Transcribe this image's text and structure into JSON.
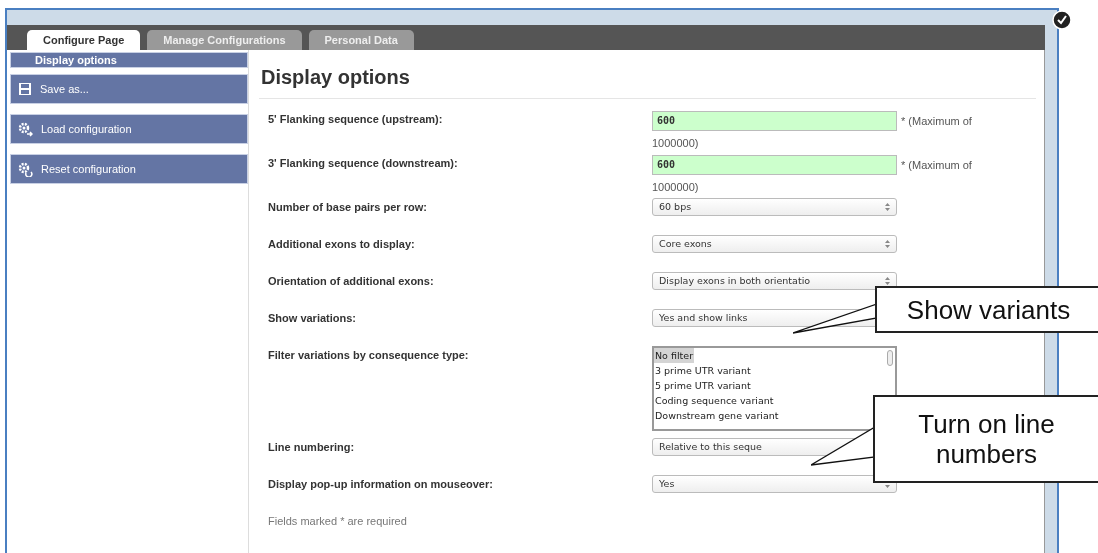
{
  "tabs": [
    {
      "label": "Configure Page",
      "selected": true
    },
    {
      "label": "Manage Configurations",
      "selected": false
    },
    {
      "label": "Personal Data",
      "selected": false
    }
  ],
  "sidebar": {
    "heading": "Display options",
    "items": [
      {
        "kind": "save",
        "label": "Save as..."
      },
      {
        "kind": "load",
        "label": "Load configuration"
      },
      {
        "kind": "reset",
        "label": "Reset configuration"
      }
    ]
  },
  "main": {
    "title": "Display options",
    "fields": [
      {
        "kind": "text",
        "label": "5' Flanking sequence (upstream):",
        "value": "600",
        "note_lines": [
          "* (Maximum of",
          "1000000)"
        ]
      },
      {
        "kind": "text",
        "label": "3' Flanking sequence (downstream):",
        "value": "600",
        "note_lines": [
          "* (Maximum of",
          "1000000)"
        ]
      },
      {
        "kind": "select",
        "label": "Number of base pairs per row:",
        "value": "60 bps"
      },
      {
        "kind": "select",
        "label": "Additional exons to display:",
        "value": "Core exons"
      },
      {
        "kind": "select",
        "label": "Orientation of additional exons:",
        "value": "Display exons in both orientatio"
      },
      {
        "kind": "select",
        "label": "Show variations:",
        "value": "Yes and show links"
      },
      {
        "kind": "list",
        "label": "Filter variations by consequence type:",
        "options": [
          {
            "label": "No filter",
            "selected": true
          },
          {
            "label": "3 prime UTR variant",
            "selected": false
          },
          {
            "label": "5 prime UTR variant",
            "selected": false
          },
          {
            "label": "Coding sequence variant",
            "selected": false
          },
          {
            "label": "Downstream gene variant",
            "selected": false
          }
        ]
      },
      {
        "kind": "select",
        "label": "Line numbering:",
        "value": "Relative to this seque"
      },
      {
        "kind": "select",
        "label": "Display pop-up information on mouseover:",
        "value": "Yes"
      }
    ],
    "footer": "Fields marked * are required"
  },
  "callouts": [
    {
      "text": "Show variants"
    },
    {
      "text": "Turn on line numbers"
    }
  ]
}
